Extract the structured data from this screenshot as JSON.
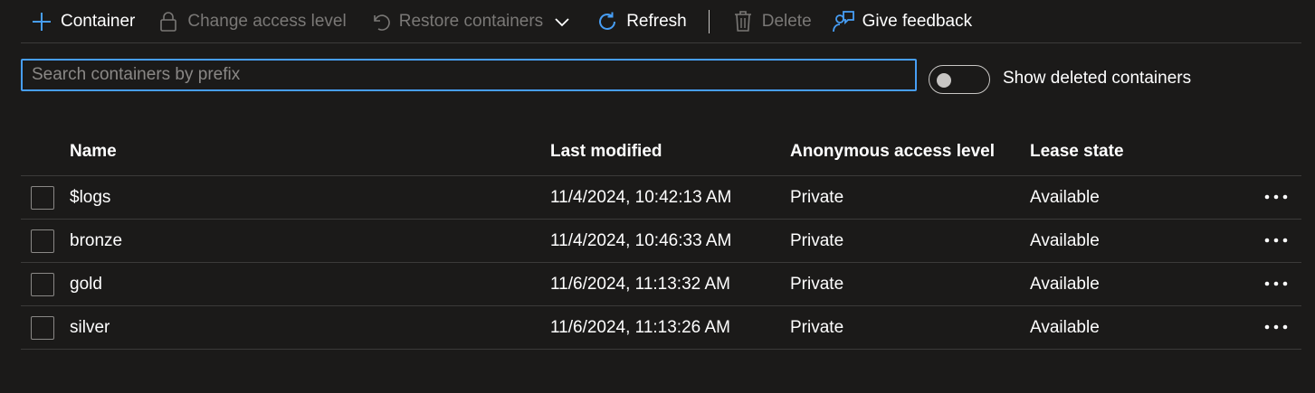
{
  "toolbar": {
    "container_label": "Container",
    "change_access_label": "Change access level",
    "restore_label": "Restore containers",
    "refresh_label": "Refresh",
    "delete_label": "Delete",
    "feedback_label": "Give feedback",
    "icons": {
      "container": "plus-icon",
      "change_access": "lock-icon",
      "restore": "undo-icon",
      "restore_dropdown": "chevron-down-icon",
      "refresh": "refresh-icon",
      "delete": "trash-icon",
      "feedback": "feedback-icon"
    }
  },
  "search": {
    "placeholder": "Search containers by prefix",
    "value": ""
  },
  "show_deleted": {
    "label": "Show deleted containers",
    "on": false
  },
  "table": {
    "columns": [
      "Name",
      "Last modified",
      "Anonymous access level",
      "Lease state"
    ],
    "rows": [
      {
        "name": "$logs",
        "last_modified": "11/4/2024, 10:42:13 AM",
        "access": "Private",
        "lease": "Available"
      },
      {
        "name": "bronze",
        "last_modified": "11/4/2024, 10:46:33 AM",
        "access": "Private",
        "lease": "Available"
      },
      {
        "name": "gold",
        "last_modified": "11/6/2024, 11:13:32 AM",
        "access": "Private",
        "lease": "Available"
      },
      {
        "name": "silver",
        "last_modified": "11/6/2024, 11:13:26 AM",
        "access": "Private",
        "lease": "Available"
      }
    ]
  },
  "colors": {
    "background": "#1b1a19",
    "accent": "#479ef5",
    "text": "#ffffff",
    "disabled_text": "#7a7876",
    "divider": "#3b3a39"
  }
}
